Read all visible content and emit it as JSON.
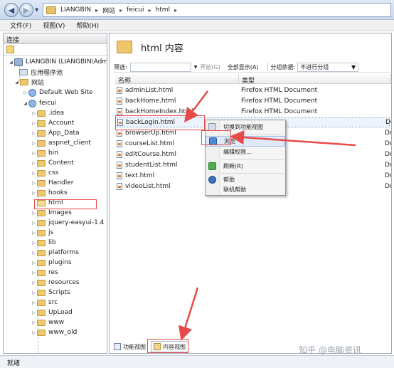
{
  "address": {
    "crumbs": [
      "LIANGBIN",
      "网站",
      "feicui",
      "html"
    ]
  },
  "menu": {
    "file": "文件(F)",
    "view": "视图(V)",
    "help": "帮助(H)"
  },
  "left_pane": {
    "header": "连接",
    "server": "LIANGBIN (LIANGBIN\\Adm",
    "app_pools": "应用程序池",
    "sites": "网站",
    "default_site": "Default Web Site",
    "site": "feicui",
    "folders": [
      ".idea",
      "Account",
      "App_Data",
      "aspnet_client",
      "bin",
      "Content",
      "css",
      "Handler",
      "hooks",
      "html",
      "Images",
      "jquery-easyui-1.4",
      "js",
      "lib",
      "platforms",
      "plugins",
      "res",
      "resources",
      "Scripts",
      "src",
      "UpLoad",
      "www",
      "www_old"
    ]
  },
  "right_pane": {
    "title": "html 内容",
    "filter_label": "筛选:",
    "go_label": "开始(G)",
    "show_all_label": "全部显示(A)",
    "group_label": "分组依据:",
    "group_value": "不进行分组",
    "col_name": "名称",
    "col_type": "类型",
    "files": [
      {
        "name": "adminList.html",
        "type": "Firefox HTML Document"
      },
      {
        "name": "backHome.html",
        "type": "Firefox HTML Document"
      },
      {
        "name": "backHomeIndex.html",
        "type": "Firefox HTML Document"
      },
      {
        "name": "backLogin.html",
        "type": "Document"
      },
      {
        "name": "browserUp.html",
        "type": "Document"
      },
      {
        "name": "courseList.html",
        "type": "Document"
      },
      {
        "name": "editCourse.html",
        "type": "Document"
      },
      {
        "name": "studentList.html",
        "type": "Document"
      },
      {
        "name": "text.html",
        "type": "Document"
      },
      {
        "name": "videoList.html",
        "type": "Document"
      }
    ]
  },
  "context_menu": {
    "switch_view": "切换到功能视图",
    "browse": "浏览",
    "edit_perm": "编辑权限...",
    "refresh": "刷新(R)",
    "help": "帮助",
    "online_help": "联机帮助"
  },
  "bottom_tabs": {
    "features": "功能视图",
    "content": "内容视图"
  },
  "watermark": "知乎 @电脑资讯",
  "status": "就绪",
  "colors": {
    "annotation_red": "#e84a4a",
    "selection_blue": "#eef4fc"
  }
}
